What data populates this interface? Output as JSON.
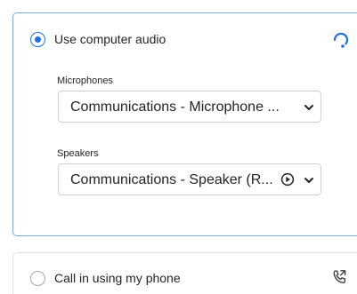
{
  "computer_audio": {
    "label": "Use computer audio",
    "selected": true,
    "accent_color": "#1f6fe5",
    "status_icon": "loading-headset-icon",
    "microphones": {
      "label": "Microphones",
      "value": "Communications - Microphone ..."
    },
    "speakers": {
      "label": "Speakers",
      "value": "Communications - Speaker (R...",
      "test_icon": "play-circle-icon"
    }
  },
  "phone_audio": {
    "label": "Call in using my phone",
    "selected": false,
    "icon": "phone-call-icon"
  }
}
